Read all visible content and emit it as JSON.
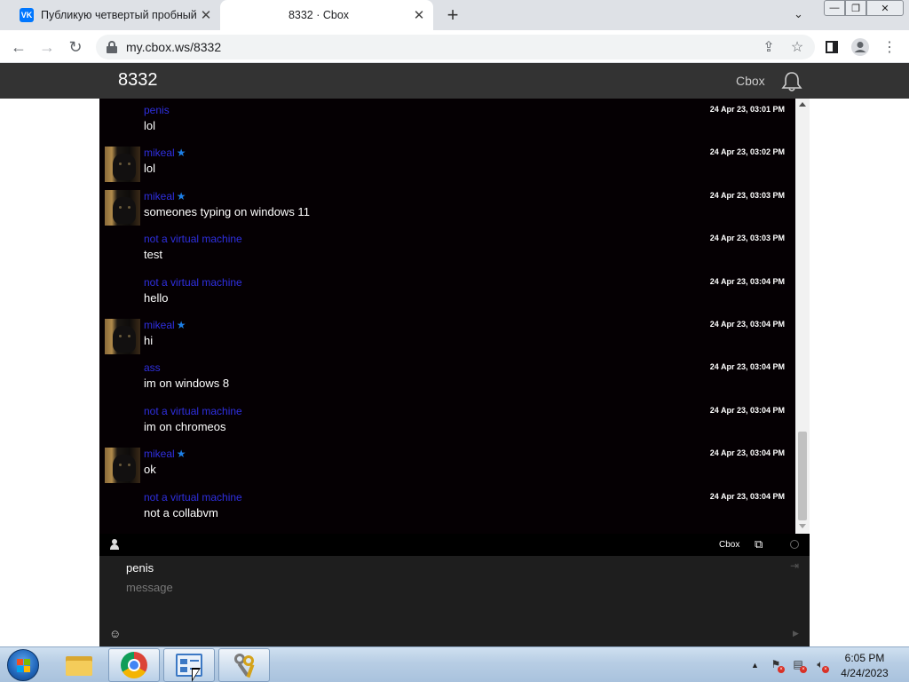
{
  "browser": {
    "tabs": [
      {
        "title": "Публикую четвертый пробный",
        "icon": "vk-icon"
      },
      {
        "title": "8332 · Cbox",
        "icon": ""
      }
    ],
    "url": "my.cbox.ws/8332",
    "window_controls": {
      "minimize": "—",
      "maximize": "❐",
      "close": "✕"
    }
  },
  "cbox": {
    "room_title": "8332",
    "header_link": "Cbox",
    "messages": [
      {
        "name": "penis",
        "star": false,
        "text": "lol",
        "time": "24 Apr 23, 03:01 PM",
        "avatar": false
      },
      {
        "name": "mikeal",
        "star": true,
        "text": "lol",
        "time": "24 Apr 23, 03:02 PM",
        "avatar": true
      },
      {
        "name": "mikeal",
        "star": true,
        "text": "someones typing on windows 11",
        "time": "24 Apr 23, 03:03 PM",
        "avatar": true
      },
      {
        "name": "not a virtual machine",
        "star": false,
        "text": "test",
        "time": "24 Apr 23, 03:03 PM",
        "avatar": false
      },
      {
        "name": "not a virtual machine",
        "star": false,
        "text": "hello",
        "time": "24 Apr 23, 03:04 PM",
        "avatar": false
      },
      {
        "name": "mikeal",
        "star": true,
        "text": "hi",
        "time": "24 Apr 23, 03:04 PM",
        "avatar": true
      },
      {
        "name": "ass",
        "star": false,
        "text": "im on windows 8",
        "time": "24 Apr 23, 03:04 PM",
        "avatar": false
      },
      {
        "name": "not a virtual machine",
        "star": false,
        "text": "im on chromeos",
        "time": "24 Apr 23, 03:04 PM",
        "avatar": false
      },
      {
        "name": "mikeal",
        "star": true,
        "text": "ok",
        "time": "24 Apr 23, 03:04 PM",
        "avatar": true
      },
      {
        "name": "not a virtual machine",
        "star": false,
        "text": "not a collabvm",
        "time": "24 Apr 23, 03:04 PM",
        "avatar": false
      }
    ],
    "toolbar": {
      "cbox_link": "Cbox"
    },
    "input": {
      "name_value": "penis",
      "message_placeholder": "message"
    },
    "colors": {
      "name": "#2f2fe0",
      "star": "#1d7fe6",
      "chat_bg": "#050003",
      "header_bg": "#333333"
    }
  },
  "taskbar": {
    "clock_time": "6:05 PM",
    "clock_date": "4/24/2023"
  }
}
